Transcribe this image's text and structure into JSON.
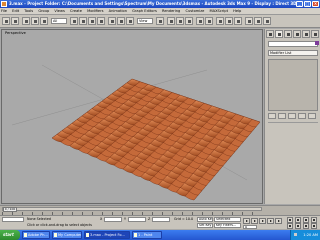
{
  "window": {
    "title": "3.max  - Project Folder: C:\\Documents and Settings\\Spectrum\\My Documents\\3dsmax   - Autodesk 3ds Max 9   - Display : Direct 3D",
    "minimize_icon": "minimize-icon",
    "maximize_icon": "maximize-icon",
    "close_icon": "close-icon"
  },
  "menu": {
    "items": [
      "File",
      "Edit",
      "Tools",
      "Group",
      "Views",
      "Create",
      "Modifiers",
      "Animation",
      "Graph Editors",
      "Rendering",
      "Customize",
      "MAXScript",
      "Help"
    ]
  },
  "toolbar": {
    "selection_filter": "All",
    "reference_coord": "View"
  },
  "viewport": {
    "label": "Perspective",
    "object": "tiled-roof-plane",
    "tile_color": "#c56a3a",
    "shadow_color": "#7a3418"
  },
  "command_panel": {
    "tabs": [
      "create-tab-icon",
      "modify-tab-icon",
      "hierarchy-tab-icon",
      "motion-tab-icon",
      "display-tab-icon",
      "utilities-tab-icon"
    ],
    "object_name": "",
    "modifier_list": "Modifier List"
  },
  "timeline": {
    "frame_display": "0 / 100"
  },
  "status": {
    "selection": "None Selected",
    "prompt": "Click or click-and-drag to select objects",
    "x_label": "X",
    "y_label": "Y",
    "z_label": "Z",
    "grid": "Grid = 10.0",
    "auto_key": "Auto Key",
    "set_key": "Set Key",
    "key_filter": "Selected",
    "key_filters": "Key Filters...",
    "frame": "0"
  },
  "taskbar": {
    "start": "start",
    "tasks": [
      "Adobe Ph...",
      "My Computer",
      "3.max - Project Fo...",
      "1 - Paint"
    ],
    "time": "1:20 AM"
  }
}
